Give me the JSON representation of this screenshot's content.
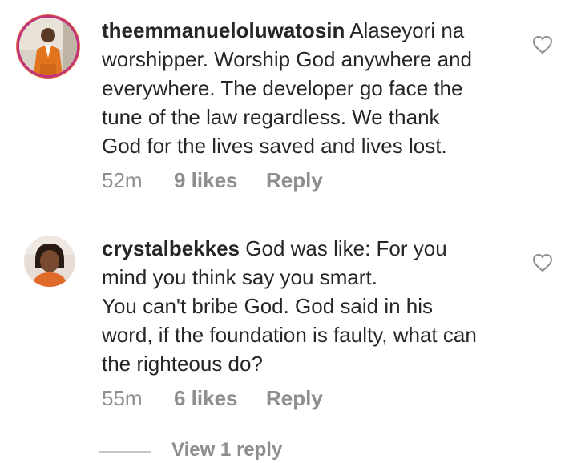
{
  "comments": [
    {
      "username": "theemmanueloluwatosin",
      "lines": [
        "Alaseyori na",
        "worshipper. Worship God anywhere and",
        "everywhere. The developer go face the",
        "tune of the law regardless.  We thank",
        "God for the lives saved and lives lost."
      ],
      "time": "52m",
      "likes": "9 likes",
      "reply_label": "Reply",
      "avatar_icon": "user-avatar-orange-suit",
      "like_icon": "heart-outline-icon"
    },
    {
      "username": "crystalbekkes",
      "lines": [
        "God was like: For you",
        "mind you think say you smart.",
        "You can't bribe God. God said in his",
        "word, if the foundation is faulty, what can",
        "the righteous do?"
      ],
      "time": "55m",
      "likes": "6 likes",
      "reply_label": "Reply",
      "avatar_icon": "user-avatar-woman",
      "like_icon": "heart-outline-icon"
    }
  ],
  "view_replies": "View 1 reply",
  "colors": {
    "text": "#262626",
    "secondary": "#8e8e8e",
    "divider": "#c7c7c7"
  }
}
